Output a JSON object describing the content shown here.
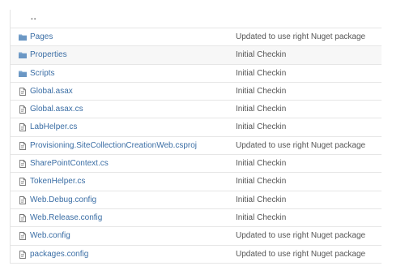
{
  "parent_dir": {
    "label": ".."
  },
  "rows": [
    {
      "name": "Pages",
      "type": "folder",
      "icon": "folder-icon",
      "message": "Updated to use right Nuget package"
    },
    {
      "name": "Properties",
      "type": "folder",
      "icon": "folder-icon",
      "message": "Initial Checkin"
    },
    {
      "name": "Scripts",
      "type": "folder",
      "icon": "folder-icon",
      "message": "Initial Checkin"
    },
    {
      "name": "Global.asax",
      "type": "file",
      "icon": "file-icon",
      "message": "Initial Checkin"
    },
    {
      "name": "Global.asax.cs",
      "type": "file",
      "icon": "file-icon",
      "message": "Initial Checkin"
    },
    {
      "name": "LabHelper.cs",
      "type": "file",
      "icon": "file-icon",
      "message": "Initial Checkin"
    },
    {
      "name": "Provisioning.SiteCollectionCreationWeb.csproj",
      "type": "file",
      "icon": "file-icon",
      "message": "Updated to use right Nuget package"
    },
    {
      "name": "SharePointContext.cs",
      "type": "file",
      "icon": "file-icon",
      "message": "Initial Checkin"
    },
    {
      "name": "TokenHelper.cs",
      "type": "file",
      "icon": "file-icon",
      "message": "Initial Checkin"
    },
    {
      "name": "Web.Debug.config",
      "type": "file",
      "icon": "file-icon",
      "message": "Initial Checkin"
    },
    {
      "name": "Web.Release.config",
      "type": "file",
      "icon": "file-icon",
      "message": "Initial Checkin"
    },
    {
      "name": "Web.config",
      "type": "file",
      "icon": "file-icon",
      "message": "Updated to use right Nuget package"
    },
    {
      "name": "packages.config",
      "type": "file",
      "icon": "file-icon",
      "message": "Updated to use right Nuget package"
    }
  ],
  "colors": {
    "link": "#3b6ea5",
    "folder_icon": "#7ea7cf",
    "file_icon": "#777777",
    "row_border": "#e6e6e6",
    "shaded_row": "#f7f7f7"
  }
}
